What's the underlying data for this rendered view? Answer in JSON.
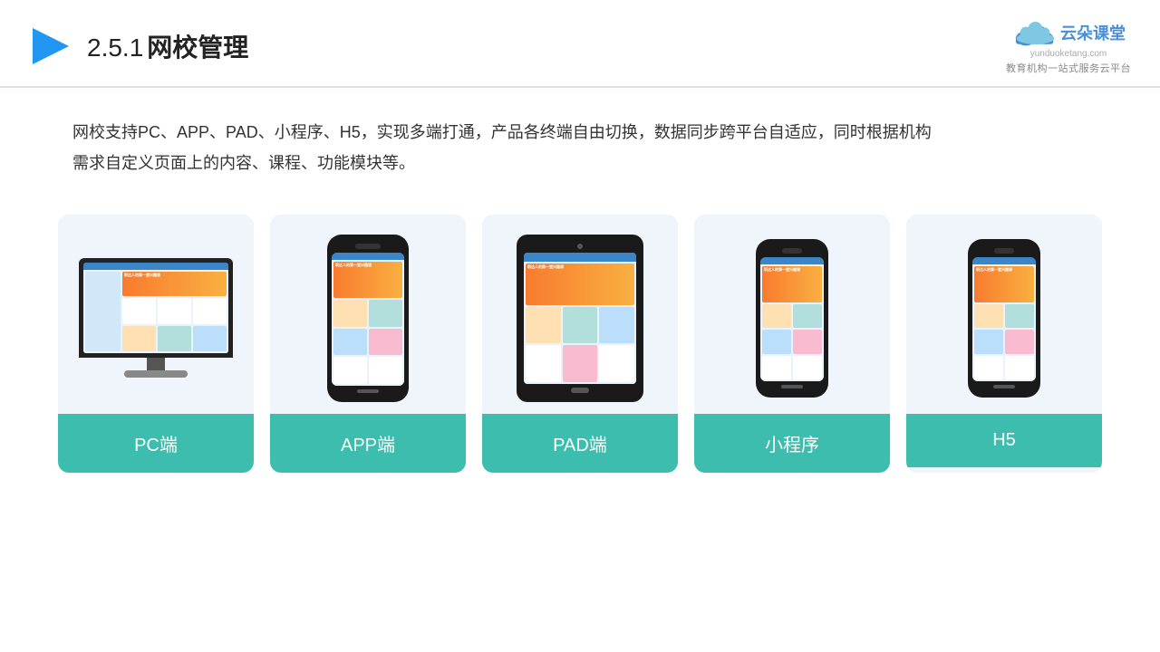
{
  "header": {
    "title_num": "2.5.1",
    "title_main": "网校管理",
    "logo_name": "云朵课堂",
    "logo_domain": "yunduoketang.com",
    "logo_tagline": "教育机构一站",
    "logo_tagline2": "式服务云平台"
  },
  "description": {
    "text": "网校支持PC、APP、PAD、小程序、H5，实现多端打通，产品各终端自由切换，数据同步跨平台自适应，同时根据机构",
    "text2": "需求自定义页面上的内容、课程、功能模块等。"
  },
  "cards": [
    {
      "id": "pc",
      "label": "PC端"
    },
    {
      "id": "app",
      "label": "APP端"
    },
    {
      "id": "pad",
      "label": "PAD端"
    },
    {
      "id": "miniprogram",
      "label": "小程序"
    },
    {
      "id": "h5",
      "label": "H5"
    }
  ]
}
